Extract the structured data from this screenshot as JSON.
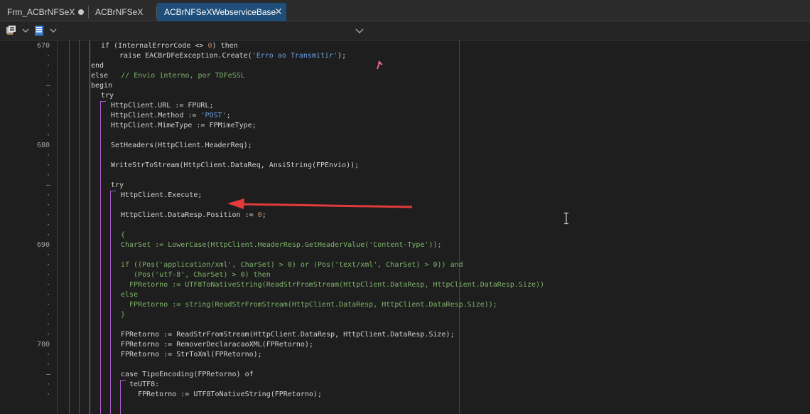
{
  "tabs": [
    {
      "label": "Frm_ACBrNFSeX",
      "modified": true
    },
    {
      "label": "ACBrNFSeX",
      "modified": false
    },
    {
      "label": "ACBrNFSeXWebserviceBase",
      "active": true
    }
  ],
  "close_glyph": "✕",
  "toolbar": {
    "icons": [
      "component-palette-icon",
      "unit-view-icon"
    ]
  },
  "line_numbers": [
    "670",
    "680",
    "690",
    "700"
  ],
  "gutter_marks": {
    "fold": "–",
    "dot": "·"
  },
  "code": [
    {
      "t": [
        {
          "c": "if (InternalErrorCode <> ",
          "k": "kw"
        },
        {
          "c": "0",
          "k": "num"
        },
        {
          "c": ") then",
          "k": "kw"
        }
      ]
    },
    {
      "t": [
        {
          "c": "  raise EACBrDFeException.Create(",
          "k": "kw"
        },
        {
          "c": "'Erro ao Transmitir'",
          "k": "str"
        },
        {
          "c": ");",
          "k": "kw"
        }
      ]
    },
    {
      "t": [
        {
          "c": "end",
          "k": "kw"
        }
      ]
    },
    {
      "t": [
        {
          "c": "else   ",
          "k": "kw"
        },
        {
          "c": "// Envio interno, por TDFeSSL",
          "k": "cm"
        }
      ]
    },
    {
      "t": [
        {
          "c": "begin",
          "k": "kw"
        }
      ]
    },
    {
      "t": [
        {
          "c": "try",
          "k": "kw"
        }
      ]
    },
    {
      "t": [
        {
          "c": "HttpClient.URL := FPURL;",
          "k": "kw"
        }
      ]
    },
    {
      "t": [
        {
          "c": "HttpClient.Method := ",
          "k": "kw"
        },
        {
          "c": "'POST'",
          "k": "str"
        },
        {
          "c": ";",
          "k": "kw"
        }
      ]
    },
    {
      "t": [
        {
          "c": "HttpClient.MimeType := FPMimeType;",
          "k": "kw"
        }
      ]
    },
    {
      "t": []
    },
    {
      "t": [
        {
          "c": "SetHeaders(HttpClient.HeaderReq);",
          "k": "kw"
        }
      ]
    },
    {
      "t": []
    },
    {
      "t": [
        {
          "c": "WriteStrToStream(HttpClient.DataReq, AnsiString(FPEnvio));",
          "k": "kw"
        }
      ]
    },
    {
      "t": []
    },
    {
      "t": [
        {
          "c": "try",
          "k": "kw"
        }
      ]
    },
    {
      "t": [
        {
          "c": "HttpClient.Execute;",
          "k": "kw"
        }
      ]
    },
    {
      "t": []
    },
    {
      "t": [
        {
          "c": "HttpClient.DataResp.Position := ",
          "k": "kw"
        },
        {
          "c": "0",
          "k": "num"
        },
        {
          "c": ";",
          "k": "kw"
        }
      ]
    },
    {
      "t": []
    },
    {
      "t": [
        {
          "c": "{",
          "k": "cm"
        }
      ]
    },
    {
      "t": [
        {
          "c": "CharSet := LowerCase(HttpClient.HeaderResp.GetHeaderValue('Content-Type'));",
          "k": "cm"
        }
      ]
    },
    {
      "t": []
    },
    {
      "t": [
        {
          "c": "if ((Pos('application/xml', CharSet) > 0) or (Pos('text/xml', CharSet) > 0)) and",
          "k": "cm"
        }
      ]
    },
    {
      "t": [
        {
          "c": "   (Pos('utf-8', CharSet) > 0) then",
          "k": "cm"
        }
      ]
    },
    {
      "t": [
        {
          "c": "  FPRetorno := UTF8ToNativeString(ReadStrFromStream(HttpClient.DataResp, HttpClient.DataResp.Size))",
          "k": "cm"
        }
      ]
    },
    {
      "t": [
        {
          "c": "else",
          "k": "cm"
        }
      ]
    },
    {
      "t": [
        {
          "c": "  FPRetorno := string(ReadStrFromStream(HttpClient.DataResp, HttpClient.DataResp.Size));",
          "k": "cm"
        }
      ]
    },
    {
      "t": [
        {
          "c": "}",
          "k": "cm"
        }
      ]
    },
    {
      "t": []
    },
    {
      "t": [
        {
          "c": "FPRetorno := ReadStrFromStream(HttpClient.DataResp, HttpClient.DataResp.Size);",
          "k": "kw"
        }
      ]
    },
    {
      "t": [
        {
          "c": "FPRetorno := RemoverDeclaracaoXML(FPRetorno);",
          "k": "kw"
        }
      ]
    },
    {
      "t": [
        {
          "c": "FPRetorno := StrToXml(FPRetorno);",
          "k": "kw"
        }
      ]
    },
    {
      "t": []
    },
    {
      "t": [
        {
          "c": "case TipoEncoding(FPRetorno) of",
          "k": "kw"
        }
      ]
    },
    {
      "t": [
        {
          "c": "  teUTF8:",
          "k": "kw"
        }
      ]
    },
    {
      "t": [
        {
          "c": "    FPRetorno := UTF8ToNativeString(FPRetorno);",
          "k": "kw"
        }
      ]
    }
  ],
  "colors": {
    "background": "#1e1e1e",
    "active_tab": "#1e4e79",
    "fold_guide": "#b05cc8",
    "annotation_arrow": "#e03a3a"
  }
}
